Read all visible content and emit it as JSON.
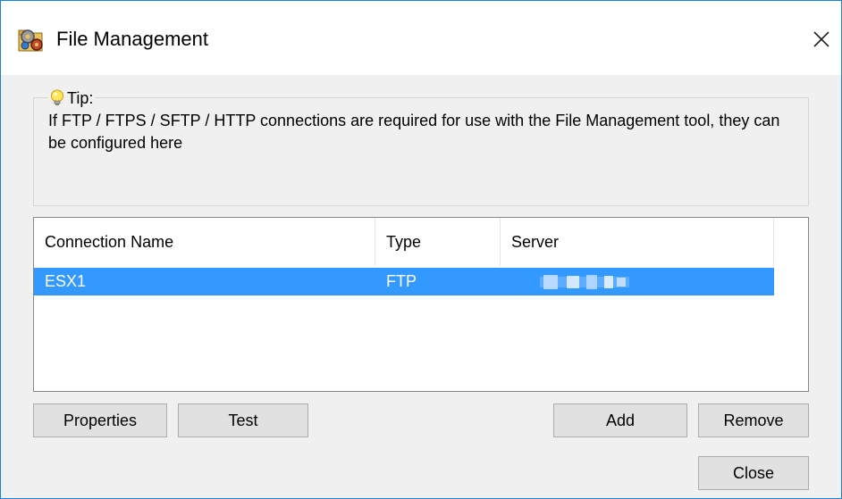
{
  "window": {
    "title": "File Management",
    "close_glyph": "✕"
  },
  "tip": {
    "label": "Tip:",
    "text": "If FTP / FTPS / SFTP / HTTP connections are required for use with the File Management tool, they can be configured here"
  },
  "connections": {
    "columns": [
      "Connection Name",
      "Type",
      "Server"
    ],
    "rows": [
      {
        "name": "ESX1",
        "type": "FTP",
        "server": ""
      }
    ]
  },
  "buttons": {
    "properties": "Properties",
    "test": "Test",
    "add": "Add",
    "remove": "Remove",
    "close": "Close"
  },
  "icons": {
    "title": "gears-folder-icon",
    "tip": "lightbulb-icon"
  },
  "colors": {
    "accent": "#1883d7",
    "selection": "#3399ff"
  }
}
